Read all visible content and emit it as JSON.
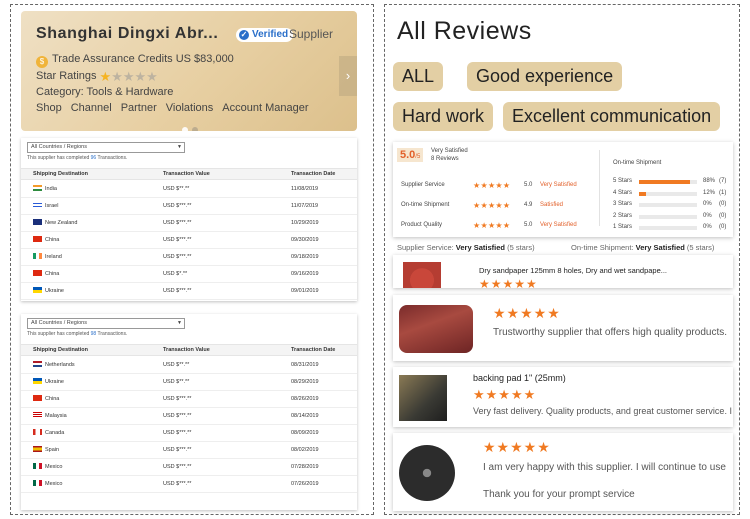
{
  "supplier_card": {
    "name": "Shanghai Dingxi Abr...",
    "verified_label": "Verified",
    "supplier_label": "Supplier",
    "trade_assurance": "Trade Assurance Credits US $83,000",
    "star_ratings_label": "Star Ratings",
    "star_rating_value": 1,
    "star_rating_max": 5,
    "category": "Category: Tools & Hardware",
    "nav": [
      "Shop",
      "Channel",
      "Partner",
      "Violations",
      "Account Manager"
    ]
  },
  "transactions": [
    {
      "region_select": "All Countries / Regions",
      "info_prefix": "This supplier has completed",
      "info_count": "96",
      "info_suffix": "Transactions.",
      "headers": [
        "Shipping Destination",
        "Transaction Value",
        "Transaction Date"
      ],
      "rows": [
        {
          "country": "India",
          "value": "USD $**.**",
          "date": "11/08/2019",
          "flag": "india"
        },
        {
          "country": "Israel",
          "value": "USD $***.**",
          "date": "11/07/2019",
          "flag": "israel"
        },
        {
          "country": "New Zealand",
          "value": "USD $***.**",
          "date": "10/29/2019",
          "flag": "nz"
        },
        {
          "country": "China",
          "value": "USD $***.**",
          "date": "09/30/2019",
          "flag": "china"
        },
        {
          "country": "Ireland",
          "value": "USD $***.**",
          "date": "09/18/2019",
          "flag": "ireland"
        },
        {
          "country": "China",
          "value": "USD $*.**",
          "date": "09/16/2019",
          "flag": "china"
        },
        {
          "country": "Ukraine",
          "value": "USD $***.**",
          "date": "09/01/2019",
          "flag": "ukraine"
        }
      ]
    },
    {
      "region_select": "All Countries / Regions",
      "info_prefix": "This supplier has completed",
      "info_count": "98",
      "info_suffix": "Transactions.",
      "headers": [
        "Shipping Destination",
        "Transaction Value",
        "Transaction Date"
      ],
      "rows": [
        {
          "country": "Netherlands",
          "value": "USD $**.**",
          "date": "08/31/2019",
          "flag": "netherlands"
        },
        {
          "country": "Ukraine",
          "value": "USD $**.**",
          "date": "08/29/2019",
          "flag": "ukraine"
        },
        {
          "country": "China",
          "value": "USD $***.**",
          "date": "08/26/2019",
          "flag": "china"
        },
        {
          "country": "Malaysia",
          "value": "USD $***.**",
          "date": "08/14/2019",
          "flag": "malaysia"
        },
        {
          "country": "Canada",
          "value": "USD $***.**",
          "date": "08/09/2019",
          "flag": "canada"
        },
        {
          "country": "Spain",
          "value": "USD $***.**",
          "date": "08/02/2019",
          "flag": "spain"
        },
        {
          "country": "Mexico",
          "value": "USD $***.**",
          "date": "07/28/2019",
          "flag": "mexico"
        },
        {
          "country": "Mexico",
          "value": "USD $***.**",
          "date": "07/26/2019",
          "flag": "mexico"
        }
      ]
    }
  ],
  "reviews": {
    "title": "All Reviews",
    "tags": [
      "ALL",
      "Good experience",
      "Hard work",
      "Excellent communication"
    ],
    "summary": {
      "score": "5.0",
      "score_max": "/5",
      "review_count": "8 Reviews",
      "metrics": [
        {
          "label": "Supplier Service",
          "score": "5.0",
          "text": "Very Satisfied"
        },
        {
          "label": "On-time Shipment",
          "score": "4.9",
          "text": "Satisfied"
        },
        {
          "label": "Product Quality",
          "score": "5.0",
          "text": "Very Satisfied"
        }
      ],
      "shipment_title": "On-time Shipment",
      "distribution": [
        {
          "label": "5 Stars",
          "percent": "88%",
          "count": "(7)",
          "fill": 0.88
        },
        {
          "label": "4 Stars",
          "percent": "12%",
          "count": "(1)",
          "fill": 0.12
        },
        {
          "label": "3 Stars",
          "percent": "0%",
          "count": "(0)",
          "fill": 0
        },
        {
          "label": "2 Stars",
          "percent": "0%",
          "count": "(0)",
          "fill": 0
        },
        {
          "label": "1 Stars",
          "percent": "0%",
          "count": "(0)",
          "fill": 0
        }
      ]
    },
    "ratings_line": {
      "service_label": "Supplier Service:",
      "service_value": "Very Satisfied",
      "service_stars": "(5 stars)",
      "shipment_label": "On-time Shipment:",
      "shipment_value": "Very Satisfied",
      "shipment_stars": "(5 stars)"
    },
    "items": [
      {
        "product": "Dry sandpaper 125mm 8 holes, Dry and wet sandpape...",
        "stars": "★★★★★",
        "text": ""
      },
      {
        "product": "",
        "stars": "★★★★★",
        "text": "Trustworthy supplier that offers high quality products."
      },
      {
        "product": "backing pad 1\" (25mm)",
        "stars": "★★★★★",
        "text": "Very fast delivery. Quality products, and great customer service. I wi"
      },
      {
        "product": "",
        "stars": "★★★★★",
        "text": "I am very happy with this supplier. I will continue to use",
        "text2": "Thank you for your prompt service"
      }
    ]
  },
  "colors": {
    "accent": "#f07a22",
    "link": "#2a6fc9",
    "card_bg": "#e7cfa2",
    "tag_bg": "#e3cfa4"
  }
}
